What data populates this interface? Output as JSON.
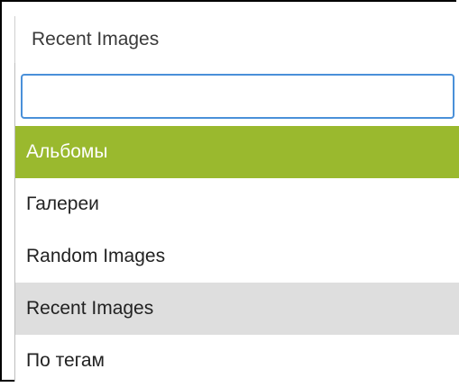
{
  "select": {
    "current_value": "Recent Images"
  },
  "search": {
    "value": "",
    "placeholder": ""
  },
  "options": [
    {
      "label": "Альбомы",
      "state": "selected"
    },
    {
      "label": "Галереи",
      "state": "normal"
    },
    {
      "label": "Random Images",
      "state": "normal"
    },
    {
      "label": "Recent Images",
      "state": "hover"
    },
    {
      "label": "По тегам",
      "state": "normal"
    }
  ],
  "colors": {
    "selected_bg": "#9ab92e",
    "hover_bg": "#dedede",
    "focus_border": "#4a90d9"
  }
}
